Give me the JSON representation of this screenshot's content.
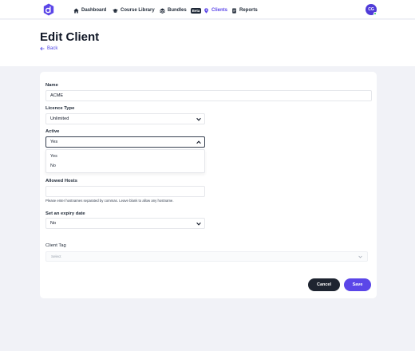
{
  "nav": {
    "items": [
      {
        "label": "Dashboard",
        "icon": "home-icon"
      },
      {
        "label": "Course Library",
        "icon": "graduation-cap-icon"
      },
      {
        "label": "Bundles",
        "icon": "layers-icon",
        "badge": "Beta"
      },
      {
        "label": "Clients",
        "icon": "map-pin-icon",
        "active": true
      },
      {
        "label": "Reports",
        "icon": "document-icon"
      }
    ],
    "avatar_initials": "CG"
  },
  "header": {
    "title": "Edit Client",
    "back_label": "Back"
  },
  "form": {
    "name": {
      "label": "Name",
      "value": "ACME"
    },
    "licence_type": {
      "label": "Licence Type",
      "value": "Unlimited"
    },
    "active": {
      "label": "Active",
      "value": "Yes",
      "options": [
        "Yes",
        "No"
      ],
      "open": true
    },
    "allowed_hosts": {
      "label": "Allowed Hosts",
      "value": "",
      "help": "Please enter hostnames separated by commas. Leave blank to allow any hostname."
    },
    "expiry": {
      "label": "Set an expiry date",
      "value": "No"
    },
    "client_tag": {
      "label": "Client Tag",
      "placeholder": "Select"
    }
  },
  "actions": {
    "cancel_label": "Cancel",
    "save_label": "Save"
  },
  "colors": {
    "accent": "#5b46e8",
    "dark_button": "#1e2430",
    "page_background": "#f1f2f7"
  }
}
